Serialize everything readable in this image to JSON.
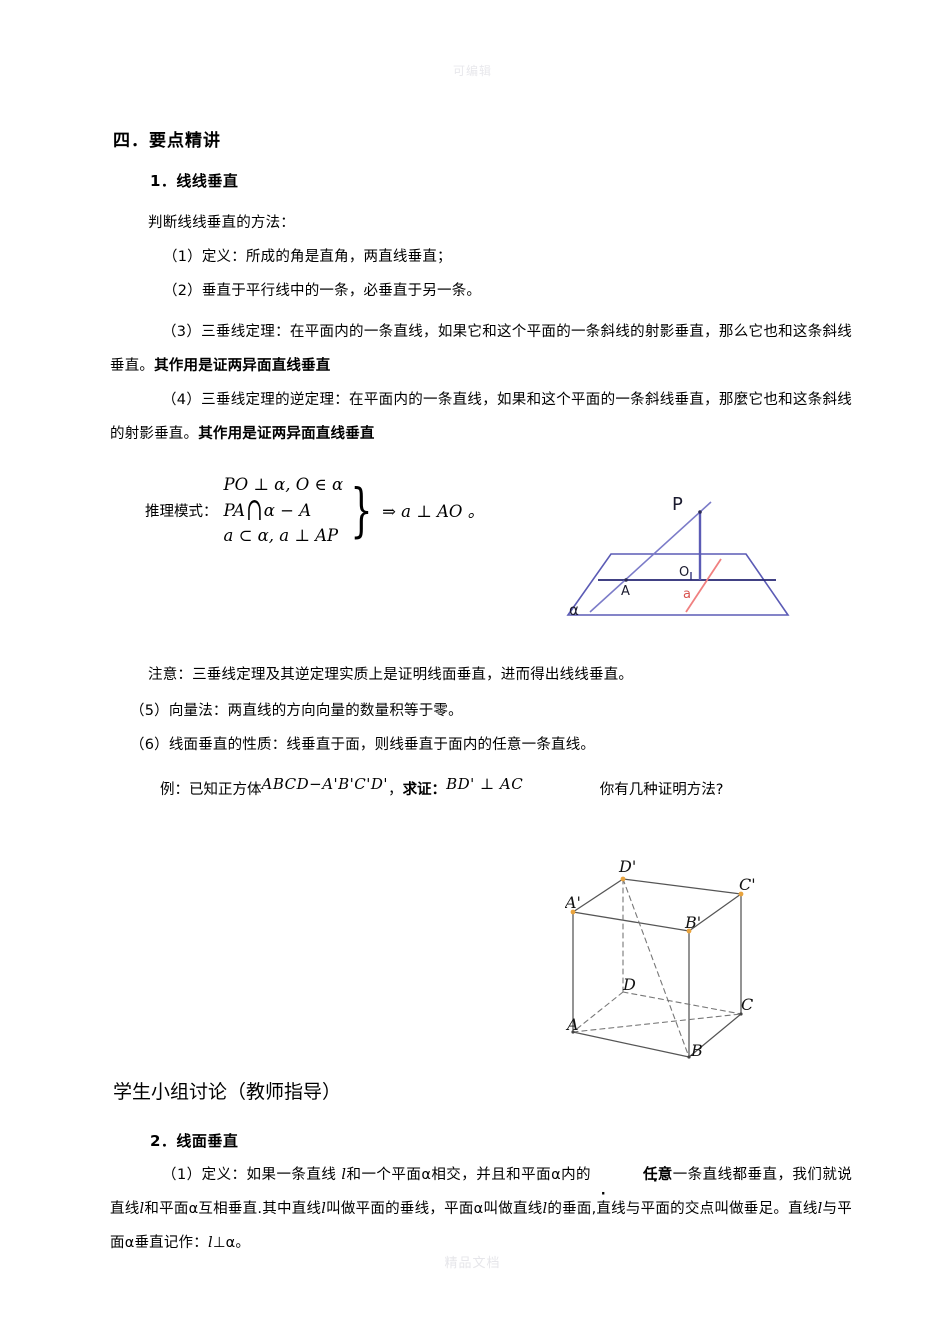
{
  "watermarks": {
    "top": "可编辑",
    "bottom": "精品文档"
  },
  "headings": {
    "section": "四．要点精讲",
    "sub1": "1．线线垂直",
    "sub2": "2．线面垂直",
    "group_activity": "学生小组讨论（教师指导）"
  },
  "section1": {
    "lead": "判断线线垂直的方法：",
    "item1": "（1）定义：所成的角是直角，两直线垂直；",
    "item2": "（2）垂直于平行线中的一条，必垂直于另一条。",
    "item3_normal": "（3）三垂线定理：在平面内的一条直线，如果它和这个平面的一条斜线的射影垂直，那么它也和这条斜线垂直。",
    "item3_bold": "其作用是证两异面直线垂直",
    "item4_normal": "（4）三垂线定理的逆定理：在平面内的一条直线，如果和这个平面的一条斜线垂直，那麼它也和这条斜线的射影垂直。",
    "item4_bold": "其作用是证两异面直线垂直",
    "note": "注意：三垂线定理及其逆定理实质上是证明线面垂直，进而得出线线垂直。",
    "item5": "（5）向量法：两直线的方向向量的数量积等于零。",
    "item6": "（6）线面垂直的性质：线垂直于面，则线垂直于面内的任意一条直线。"
  },
  "formula": {
    "label": "推理模式：",
    "line1": "PO ⊥ α, O ∈ α",
    "line2_left": "PA",
    "line2_mid": "∩",
    "line2_right": "α − A",
    "line3": "a ⊂ α, a ⊥ AP",
    "conclusion": "⇒ a ⊥ AO 。"
  },
  "example": {
    "prefix": "例：已知正方体",
    "cube_name": "ABCD−A'B'C'D'",
    "middle": "，",
    "prove_label": "求证：",
    "statement": "BD' ⊥ AC",
    "question": "你有几种证明方法?"
  },
  "plane_diagram": {
    "labels": {
      "p": "P",
      "o": "O",
      "a_point": "A",
      "line_a": "a",
      "alpha": "α"
    },
    "colors": {
      "plane_edge": "#5b5bb5",
      "baseline": "#262673",
      "line_a": "#f08080",
      "label": "#1a1a2e"
    }
  },
  "cube_diagram": {
    "labels": {
      "a": "A",
      "b": "B",
      "c": "C",
      "d": "D",
      "a_prime": "A'",
      "b_prime": "B'",
      "c_prime": "C'",
      "d_prime": "D'"
    },
    "colors": {
      "edge": "#555555",
      "hidden": "#888888",
      "vertex": "#e8a33d"
    }
  },
  "section2": {
    "item1_part1": "（1）定义：如果一条直线",
    "item1_l1": "l",
    "item1_part2": "和一个平面α相交，并且和平面α内的",
    "item1_emph": "任意",
    "item1_part3": "一条直线都垂直，我们就说直线",
    "item1_l2": "l",
    "item1_part4": "和平面α互相垂直.其中直线",
    "item1_l3": "l",
    "item1_part5": "叫做平面的垂线，平面α叫做直线",
    "item1_l4": "l",
    "item1_part6": "的垂面,直线与平面的交点叫做垂足。直线",
    "item1_l5": "l",
    "item1_part7": "与平面α垂直记作：",
    "item1_l6": "l",
    "item1_part8": "⊥α。"
  }
}
